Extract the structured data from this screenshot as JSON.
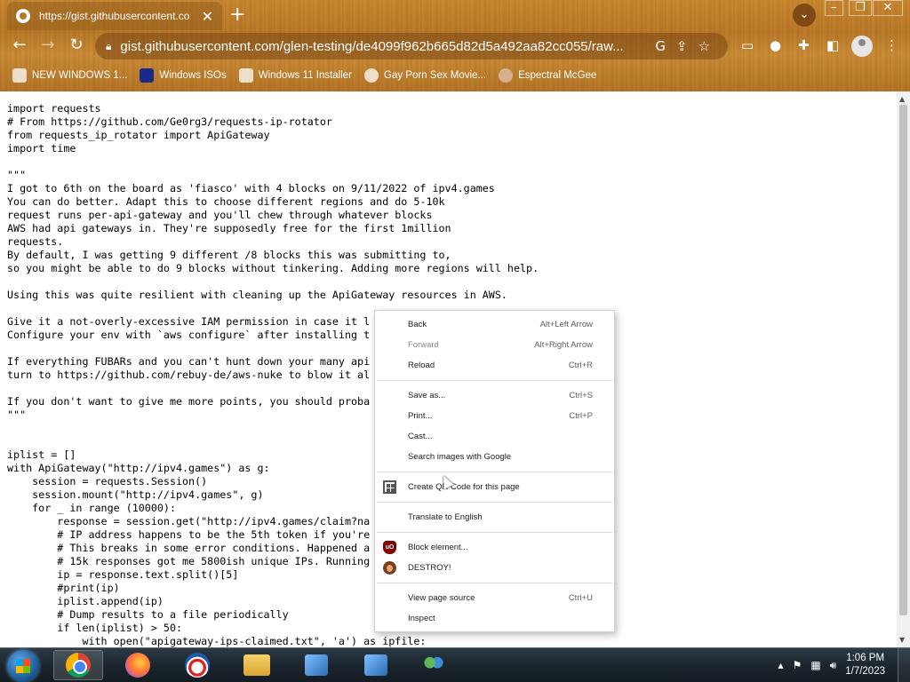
{
  "browser": {
    "tab_title": "https://gist.githubusercontent.co",
    "url": "gist.githubusercontent.com/glen-testing/de4099f962b665d82d5a492aa82cc055/raw...",
    "bookmarks": [
      {
        "label": "NEW WINDOWS 1...",
        "icon": "windows-icon"
      },
      {
        "label": "Windows ISOs",
        "icon": "x-icon"
      },
      {
        "label": "Windows 11 Installer",
        "icon": "installer-icon"
      },
      {
        "label": "Gay Porn Sex Movie...",
        "icon": "globe-icon"
      },
      {
        "label": "Espectral McGee",
        "icon": "bookmark-icon"
      }
    ]
  },
  "page": {
    "code_lines": [
      "import requests",
      "# From https://github.com/Ge0rg3/requests-ip-rotator",
      "from requests_ip_rotator import ApiGateway",
      "import time",
      "",
      "\"\"\"",
      "I got to 6th on the board as 'fiasco' with 4 blocks on 9/11/2022 of ipv4.games",
      "You can do better. Adapt this to choose different regions and do 5-10k",
      "request runs per-api-gateway and you'll chew through whatever blocks",
      "AWS had api gateways in. They're supposedly free for the first 1million",
      "requests.",
      "By default, I was getting 9 different /8 blocks this was submitting to,",
      "so you might be able to do 9 blocks without tinkering. Adding more regions will help.",
      "",
      "Using this was quite resilient with cleaning up the ApiGateway resources in AWS.",
      "",
      "Give it a not-overly-excessive IAM permission in case it l",
      "Configure your env with `aws configure` after installing t",
      "",
      "If everything FUBARs and you can't hunt down your many api",
      "turn to https://github.com/rebuy-de/aws-nuke to blow it al",
      "",
      "If you don't want to give me more points, you should proba                                 yours.",
      "\"\"\"",
      "",
      "",
      "iplist = []",
      "with ApiGateway(\"http://ipv4.games\") as g:",
      "    session = requests.Session()",
      "    session.mount(\"http://ipv4.games\", g)",
      "    for _ in range (10000):",
      "        response = session.get(\"http://ipv4.games/claim?na",
      "        # IP address happens to be the 5th token if you're",
      "        # This breaks in some error conditions. Happened a",
      "        # 15k responses got me 5800ish unique IPs. Running                                 .",
      "        ip = response.text.split()[5]",
      "        #print(ip)",
      "        iplist.append(ip)",
      "        # Dump results to a file periodically",
      "        if len(iplist) > 50:",
      "            with open(\"apigateway-ips-claimed.txt\", 'a') as ipfile:",
      "                for ip in iplist:"
    ]
  },
  "context_menu": {
    "back": "Back",
    "back_sc": "Alt+Left Arrow",
    "forward": "Forward",
    "forward_sc": "Alt+Right Arrow",
    "reload": "Reload",
    "reload_sc": "Ctrl+R",
    "save": "Save as...",
    "save_sc": "Ctrl+S",
    "print": "Print...",
    "print_sc": "Ctrl+P",
    "cast": "Cast...",
    "search_images": "Search images with Google",
    "qr": "Create QR Code for this page",
    "translate": "Translate to English",
    "block": "Block element...",
    "destroy": "DESTROY!",
    "source": "View page source",
    "source_sc": "Ctrl+U",
    "inspect": "Inspect"
  },
  "taskbar": {
    "time": "1:06 PM",
    "date": "1/7/2023"
  }
}
